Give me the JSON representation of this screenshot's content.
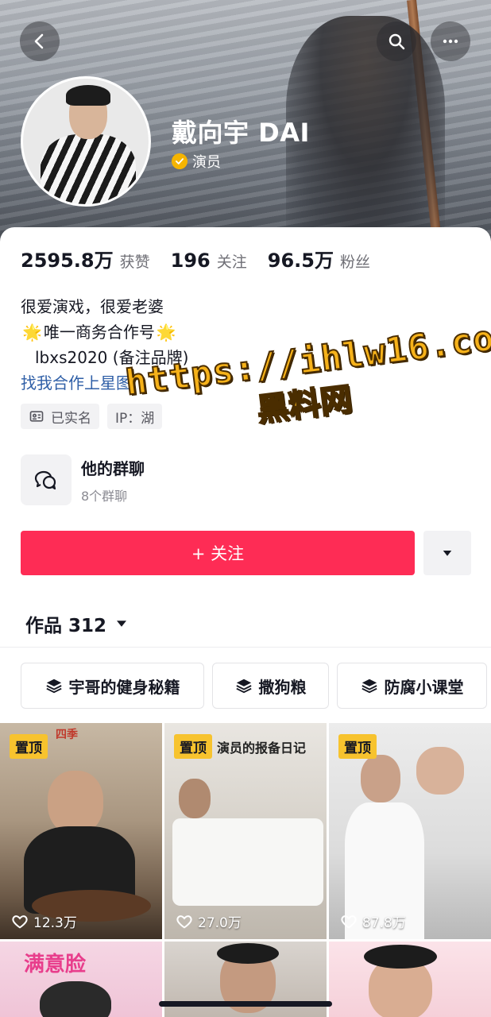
{
  "header": {
    "back_icon": "chevron-left-icon",
    "search_icon": "search-icon",
    "more_icon": "ellipsis-icon",
    "name": "戴向宇 DAI",
    "role": "演员"
  },
  "stats": [
    {
      "value": "2595.8万",
      "label": "获赞"
    },
    {
      "value": "196",
      "label": "关注"
    },
    {
      "value": "96.5万",
      "label": "粉丝"
    }
  ],
  "bio": {
    "line1": "很爱演戏，很爱老婆",
    "line2": "唯一商务合作号",
    "line3": "lbxs2020 (备注品牌)",
    "link": "找我合作上星图"
  },
  "tags": {
    "verified": "已实名",
    "ip": "IP：湖"
  },
  "group_chat": {
    "title": "他的群聊",
    "count": "8个群聊"
  },
  "follow_button": "+ 关注",
  "works_tab": "作品 312",
  "collections": [
    "宇哥的健身秘籍",
    "撒狗粮",
    "防腐小课堂"
  ],
  "videos": [
    {
      "pinned": "置顶",
      "likes": "12.3万",
      "overlay": "四季"
    },
    {
      "pinned": "置顶",
      "likes": "27.0万",
      "overlay": "演员的报备日记"
    },
    {
      "pinned": "置顶",
      "likes": "87.8万"
    },
    {
      "overlay": "满意脸"
    },
    {},
    {}
  ],
  "watermark": {
    "url": "https://ihlw16.com",
    "name": "黑料网"
  },
  "colors": {
    "accent": "#fe2c55",
    "link": "#2f5fa7",
    "pin": "#f7c32e",
    "verified": "#f5b400"
  }
}
